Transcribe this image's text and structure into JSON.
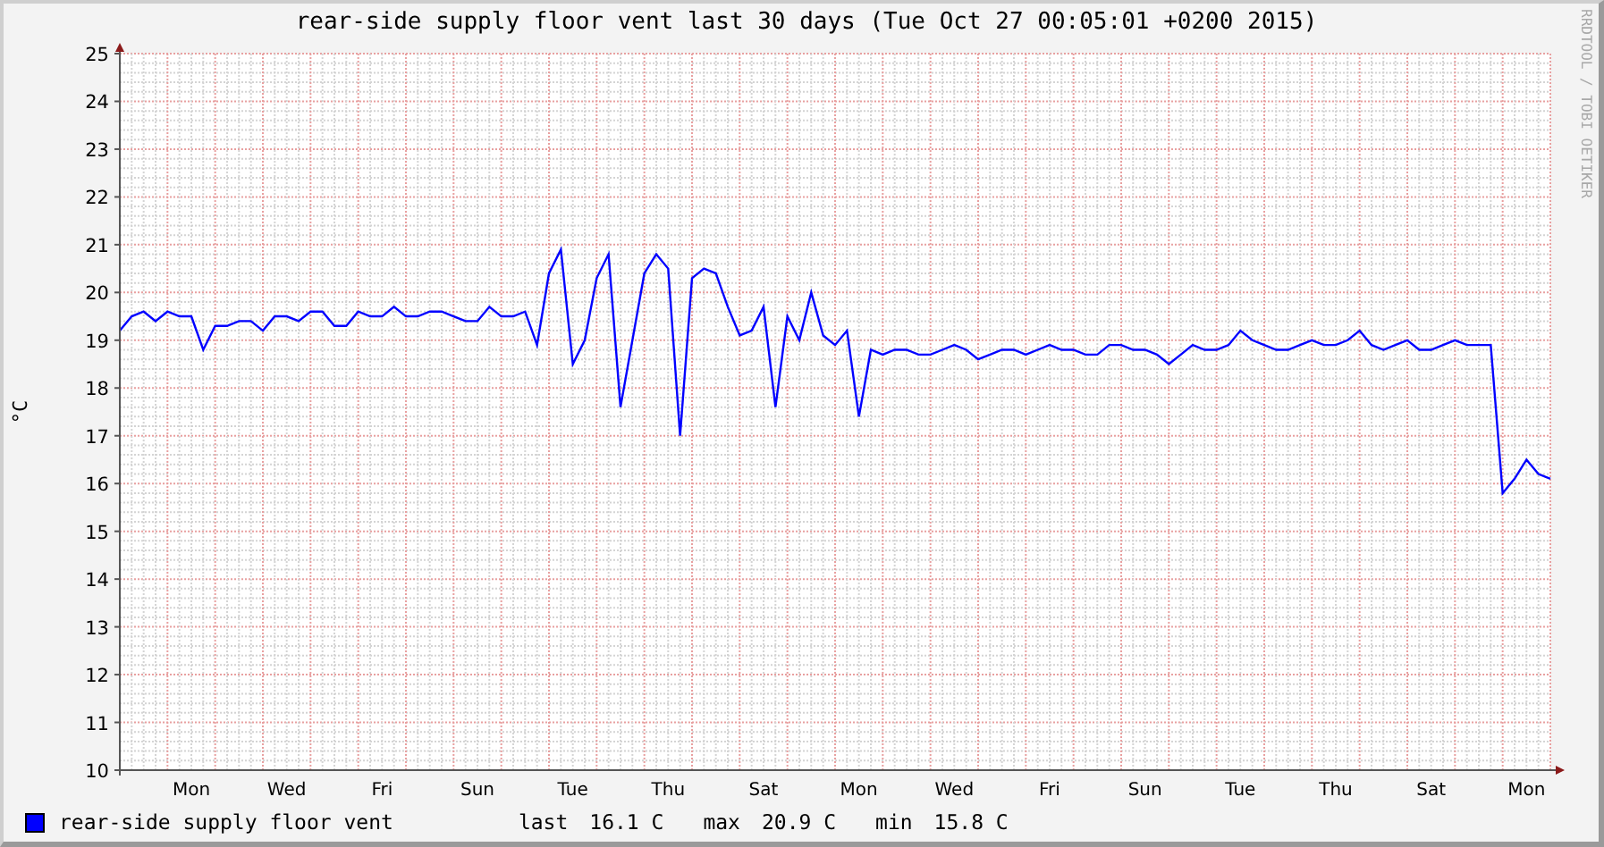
{
  "title": "rear-side supply floor vent last 30 days (Tue Oct 27 00:05:01 +0200 2015)",
  "credit": "RRDTOOL / TOBI OETIKER",
  "chart_data": {
    "type": "line",
    "grid": true,
    "ylabel": "°C",
    "ylim": [
      10,
      25
    ],
    "yticks": [
      10,
      11,
      12,
      13,
      14,
      15,
      16,
      17,
      18,
      19,
      20,
      21,
      22,
      23,
      24,
      25
    ],
    "categories": [
      null,
      null,
      null,
      null,
      null,
      null,
      "Mon",
      null,
      null,
      null,
      null,
      null,
      null,
      null,
      "Wed",
      null,
      null,
      null,
      null,
      null,
      null,
      null,
      "Fri",
      null,
      null,
      null,
      null,
      null,
      null,
      null,
      "Sun",
      null,
      null,
      null,
      null,
      null,
      null,
      null,
      "Tue",
      null,
      null,
      null,
      null,
      null,
      null,
      null,
      "Thu",
      null,
      null,
      null,
      null,
      null,
      null,
      null,
      "Sat",
      null,
      null,
      null,
      null,
      null,
      null,
      null,
      "Mon",
      null,
      null,
      null,
      null,
      null,
      null,
      null,
      "Wed",
      null,
      null,
      null,
      null,
      null,
      null,
      null,
      "Fri",
      null,
      null,
      null,
      null,
      null,
      null,
      null,
      "Sun",
      null,
      null,
      null,
      null,
      null,
      null,
      null,
      "Tue",
      null,
      null,
      null,
      null,
      null,
      null,
      null,
      "Thu",
      null,
      null,
      null,
      null,
      null,
      null,
      null,
      "Sat",
      null,
      null,
      null,
      null,
      null,
      null,
      null,
      "Mon",
      null,
      null
    ],
    "series": [
      {
        "name": "rear-side supply floor vent",
        "color": "#0000ff",
        "values": [
          19.2,
          19.5,
          19.6,
          19.4,
          19.6,
          19.5,
          19.5,
          18.8,
          19.3,
          19.3,
          19.4,
          19.4,
          19.2,
          19.5,
          19.5,
          19.4,
          19.6,
          19.6,
          19.3,
          19.3,
          19.6,
          19.5,
          19.5,
          19.7,
          19.5,
          19.5,
          19.6,
          19.6,
          19.5,
          19.4,
          19.4,
          19.7,
          19.5,
          19.5,
          19.6,
          18.9,
          20.4,
          20.9,
          18.5,
          19.0,
          20.3,
          20.8,
          17.6,
          19.0,
          20.4,
          20.8,
          20.5,
          17.0,
          20.3,
          20.5,
          20.4,
          19.7,
          19.1,
          19.2,
          19.7,
          17.6,
          19.5,
          19.0,
          20.0,
          19.1,
          18.9,
          19.2,
          17.4,
          18.8,
          18.7,
          18.8,
          18.8,
          18.7,
          18.7,
          18.8,
          18.9,
          18.8,
          18.6,
          18.7,
          18.8,
          18.8,
          18.7,
          18.8,
          18.9,
          18.8,
          18.8,
          18.7,
          18.7,
          18.9,
          18.9,
          18.8,
          18.8,
          18.7,
          18.5,
          18.7,
          18.9,
          18.8,
          18.8,
          18.9,
          19.2,
          19.0,
          18.9,
          18.8,
          18.8,
          18.9,
          19.0,
          18.9,
          18.9,
          19.0,
          19.2,
          18.9,
          18.8,
          18.9,
          19.0,
          18.8,
          18.8,
          18.9,
          19.0,
          18.9,
          18.9,
          18.9,
          15.8,
          16.1,
          16.5,
          16.2,
          16.1
        ]
      }
    ]
  },
  "legend": {
    "stats": [
      {
        "label": "last",
        "value": "16.1 C"
      },
      {
        "label": "max",
        "value": "20.9 C"
      },
      {
        "label": "min",
        "value": "15.8 C"
      }
    ]
  }
}
